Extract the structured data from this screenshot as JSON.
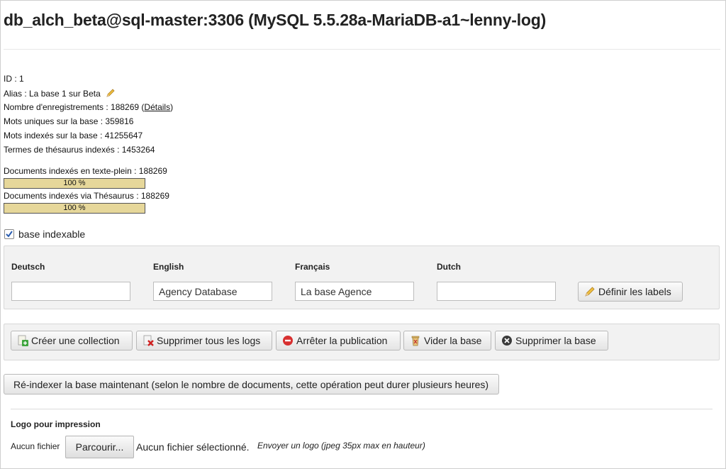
{
  "header": {
    "title": "db_alch_beta@sql-master:3306 (MySQL 5.5.28a-MariaDB-a1~lenny-log)"
  },
  "info": {
    "id": "ID : 1",
    "alias_prefix": "Alias : La base 1 sur Beta",
    "records_prefix": "Nombre d'enregistrements : 188269 (",
    "records_link": "Détails",
    "records_suffix": ")",
    "unique_words": "Mots uniques sur la base : 359816",
    "indexed_words": "Mots indexés sur la base : 41255647",
    "thesaurus_terms": "Termes de thésaurus indexés : 1453264"
  },
  "progress": {
    "fulltext_label": "Documents indexés en texte-plein : 188269",
    "fulltext_pct": 100,
    "fulltext_text": "100 %",
    "thesaurus_label": "Documents indexés via Thésaurus : 188269",
    "thesaurus_pct": 100,
    "thesaurus_text": "100 %"
  },
  "indexable": {
    "label": "base indexable",
    "checked": true
  },
  "labels_panel": {
    "deutsch_label": "Deutsch",
    "deutsch_value": "",
    "english_label": "English",
    "english_value": "Agency Database",
    "francais_label": "Français",
    "francais_value": "La base Agence",
    "dutch_label": "Dutch",
    "dutch_value": "",
    "define_button": "Définir les labels"
  },
  "actions": {
    "create_collection": "Créer une collection",
    "delete_logs": "Supprimer tous les logs",
    "stop_publication": "Arrêter la publication",
    "empty_base": "Vider la base",
    "delete_base": "Supprimer la base"
  },
  "reindex": {
    "label": "Ré-indexer la base maintenant (selon le nombre de documents, cette opération peut durer plusieurs heures)"
  },
  "logo": {
    "title": "Logo pour impression",
    "field_label": "Aucun fichier",
    "browse": "Parcourir...",
    "no_file": "Aucun fichier sélectionné.",
    "hint": "Envoyer un logo (jpeg 35px max en hauteur)"
  },
  "colors": {
    "progress_fill": "#e6d79a",
    "panel_bg": "#f2f2f2",
    "check_blue": "#2a5db0"
  },
  "icons": [
    "pencil-icon",
    "add-collection-icon",
    "delete-logs-icon",
    "stop-icon",
    "empty-base-icon",
    "delete-base-icon"
  ]
}
